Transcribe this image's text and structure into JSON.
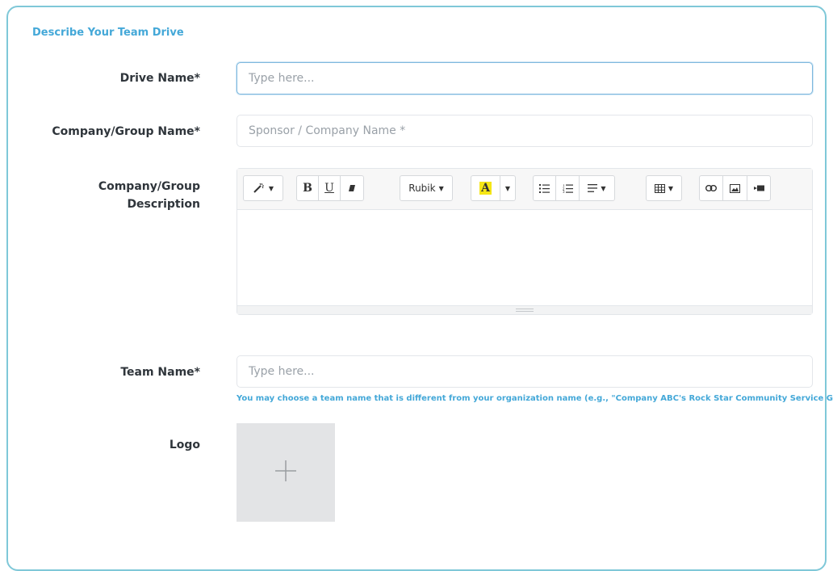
{
  "section_title": "Describe Your Team Drive",
  "fields": {
    "drive_name": {
      "label": "Drive Name*",
      "placeholder": "Type here..."
    },
    "company_name": {
      "label": "Company/Group Name*",
      "placeholder": "Sponsor / Company Name *"
    },
    "company_description": {
      "label_line1": "Company/Group",
      "label_line2": "Description"
    },
    "team_name": {
      "label": "Team Name*",
      "placeholder": "Type here...",
      "hint": "You may choose a team name that is different from your organization name (e.g., \"Company ABC's Rock Star Community Service Group\")"
    },
    "logo": {
      "label": "Logo"
    }
  },
  "toolbar": {
    "bold": "B",
    "underline": "U",
    "font_name": "Rubik",
    "font_color": "A",
    "icons": [
      "magic-icon",
      "bold-icon",
      "underline-icon",
      "eraser-icon",
      "font-family-dropdown",
      "font-color-icon",
      "color-dropdown-caret",
      "unordered-list-icon",
      "ordered-list-icon",
      "align-icon",
      "table-icon",
      "link-icon",
      "image-icon",
      "video-icon"
    ]
  },
  "colors": {
    "accent": "#44a8d8",
    "border": "#7fc8d8",
    "highlight": "#f5e616"
  }
}
